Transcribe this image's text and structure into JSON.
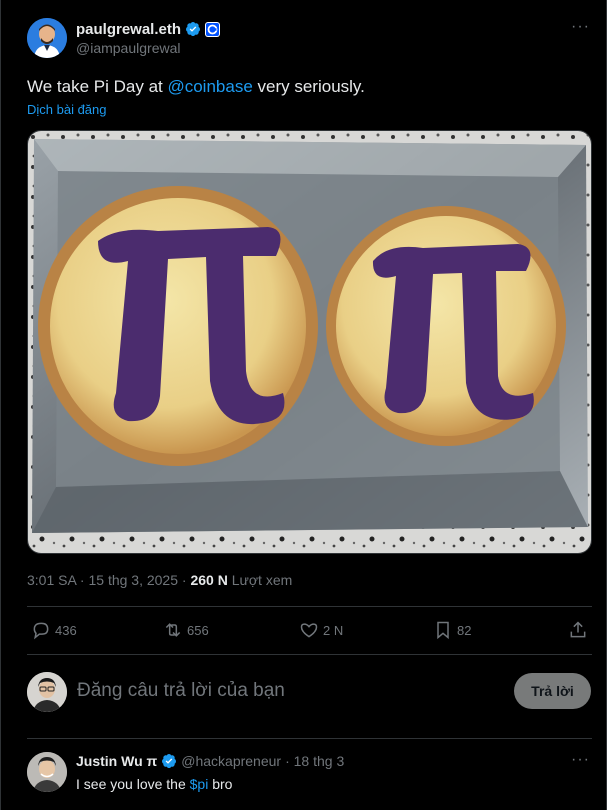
{
  "tweet": {
    "display_name": "paulgrewal.eth",
    "handle": "@iampaulgrewal",
    "text_before": "We take Pi Day at ",
    "mention": "@coinbase",
    "text_after": " very seriously.",
    "translate_label": "Dịch bài đăng",
    "time": "3:01 SA · 15 thg 3, 2025 · ",
    "views_count": "260 N",
    "views_label": " Lượt xem",
    "pi_symbol": "π"
  },
  "actions": {
    "replies": "436",
    "reposts": "656",
    "likes": "2 N",
    "bookmarks": "82"
  },
  "composer": {
    "placeholder": "Đăng câu trả lời của bạn",
    "reply_button": "Trả lời"
  },
  "reply": {
    "display_name": "Justin Wu π",
    "handle": "@hackapreneur",
    "date": "· 18 thg 3",
    "text_before": "I see you love the ",
    "cashtag": "$pi",
    "text_after": " bro"
  },
  "colors": {
    "accent": "#1d9bf0",
    "muted": "#71767b",
    "background": "#000000",
    "border": "#2f3336"
  }
}
